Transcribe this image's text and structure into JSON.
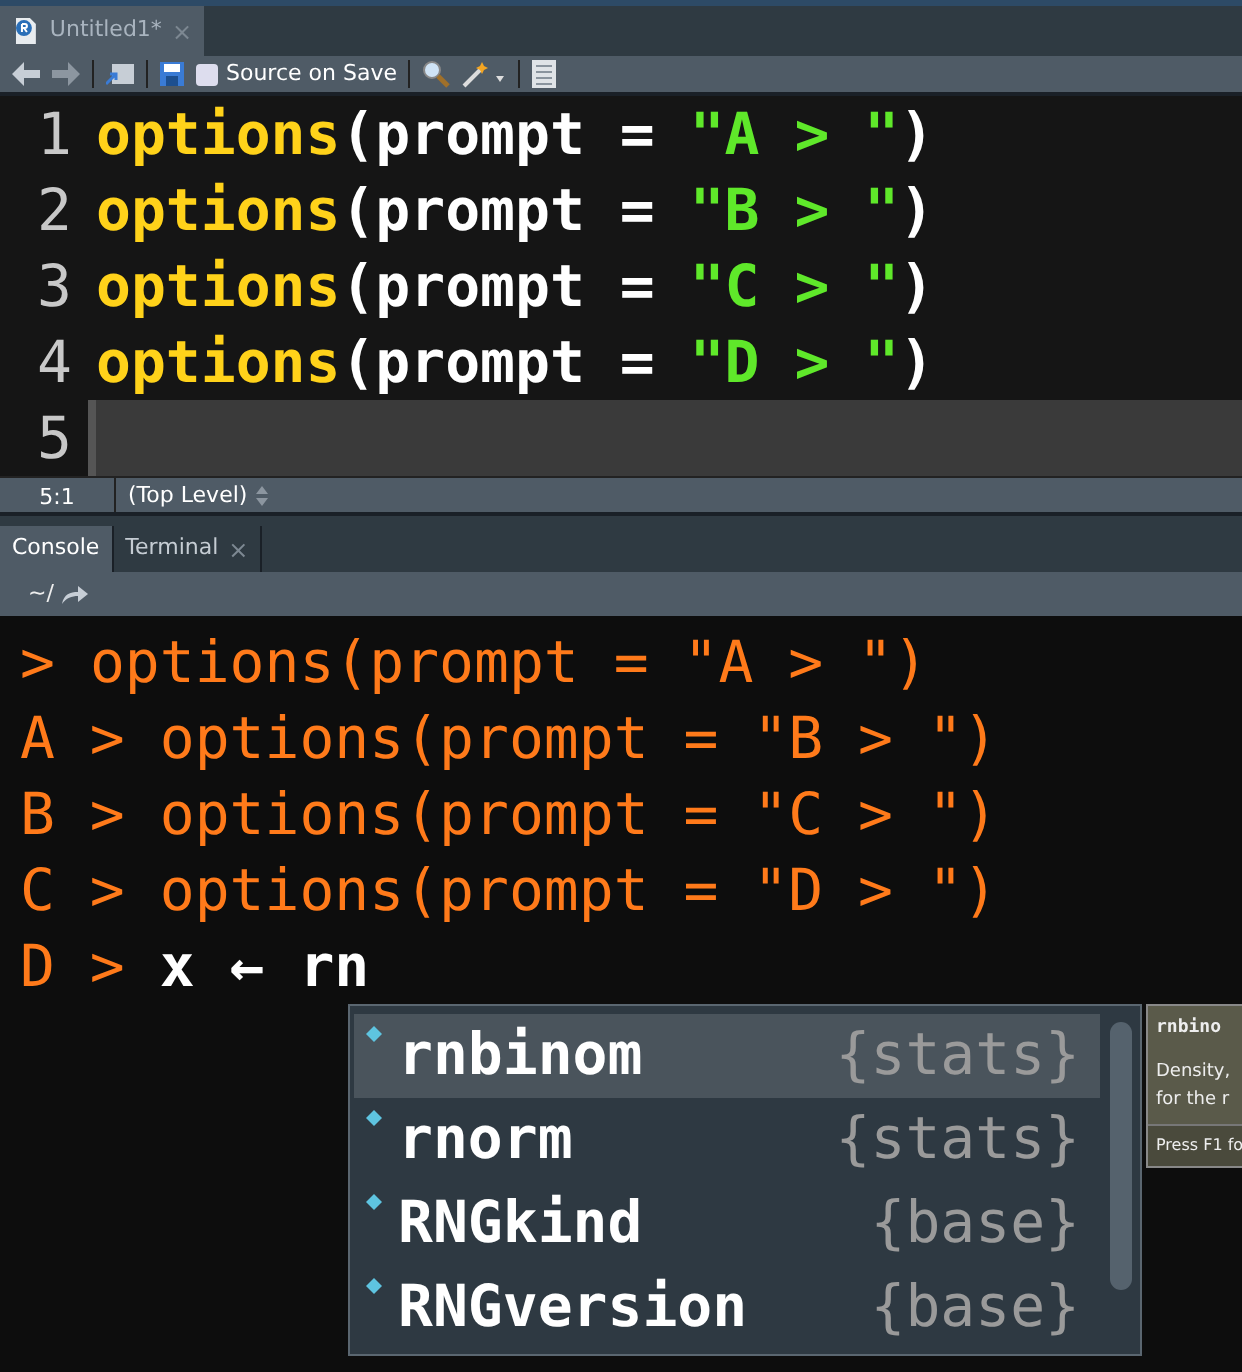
{
  "source_tab": {
    "title": "Untitled1*",
    "close": "×"
  },
  "toolbar": {
    "source_on_save": {
      "label": "Source on Save",
      "checked": false
    }
  },
  "editor": {
    "lines": [
      {
        "number": "1",
        "current": false,
        "tokens": [
          {
            "kind": "function",
            "text": "options"
          },
          {
            "kind": "plain",
            "text": "(prompt = "
          },
          {
            "kind": "string",
            "text": "\"A > \""
          },
          {
            "kind": "plain",
            "text": ")"
          }
        ]
      },
      {
        "number": "2",
        "current": false,
        "tokens": [
          {
            "kind": "function",
            "text": "options"
          },
          {
            "kind": "plain",
            "text": "(prompt = "
          },
          {
            "kind": "string",
            "text": "\"B > \""
          },
          {
            "kind": "plain",
            "text": ")"
          }
        ]
      },
      {
        "number": "3",
        "current": false,
        "tokens": [
          {
            "kind": "function",
            "text": "options"
          },
          {
            "kind": "plain",
            "text": "(prompt = "
          },
          {
            "kind": "string",
            "text": "\"C > \""
          },
          {
            "kind": "plain",
            "text": ")"
          }
        ]
      },
      {
        "number": "4",
        "current": false,
        "tokens": [
          {
            "kind": "function",
            "text": "options"
          },
          {
            "kind": "plain",
            "text": "(prompt = "
          },
          {
            "kind": "string",
            "text": "\"D > \""
          },
          {
            "kind": "plain",
            "text": ")"
          }
        ]
      },
      {
        "number": "5",
        "current": true
      }
    ]
  },
  "status": {
    "position": "5:1",
    "scope": "(Top Level)"
  },
  "console_tabs": [
    {
      "label": "Console",
      "selected": true
    },
    {
      "label": "Terminal",
      "selected": false,
      "close": "×"
    }
  ],
  "path": "~/",
  "console_lines": [
    {
      "kind": "echo",
      "prompt": ">",
      "input": "options(prompt = \"A > \")"
    },
    {
      "kind": "echo",
      "prompt": "A >",
      "input": "options(prompt = \"B > \")"
    },
    {
      "kind": "echo",
      "prompt": "B >",
      "input": "options(prompt = \"C > \")"
    },
    {
      "kind": "echo",
      "prompt": "C >",
      "input": "options(prompt = \"D > \")"
    },
    {
      "kind": "pending",
      "prompt": "D >",
      "input": "x ← rn"
    }
  ],
  "completion": {
    "items": [
      {
        "name": "rnbinom",
        "package": "{stats}",
        "selected": true
      },
      {
        "name": "rnorm",
        "package": "{stats}",
        "selected": false
      },
      {
        "name": "RNGkind",
        "package": "{base}",
        "selected": false
      },
      {
        "name": "RNGversion",
        "package": "{base}",
        "selected": false
      }
    ]
  },
  "tooltip": {
    "title": "rnbino",
    "lines": [
      "Density,",
      "for the r"
    ],
    "footer": "Press F1 fo"
  }
}
